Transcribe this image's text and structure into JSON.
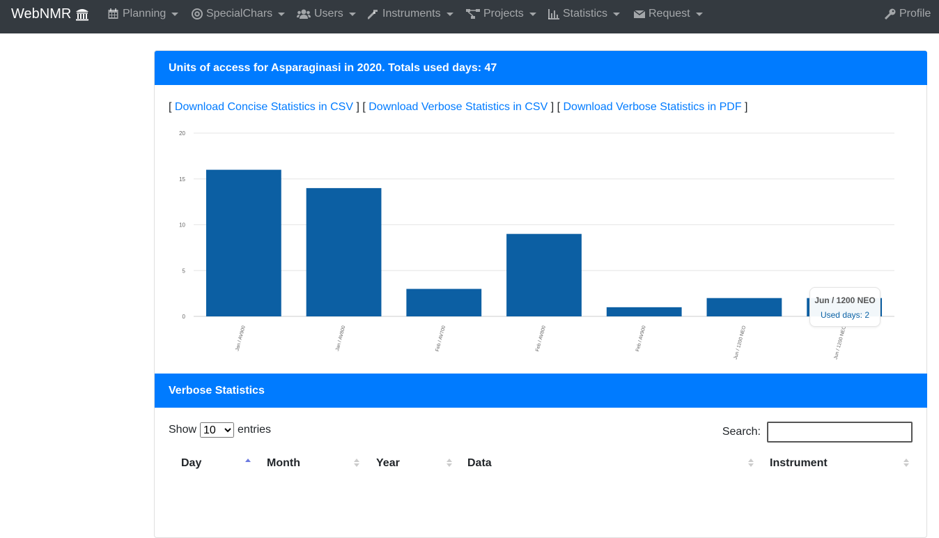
{
  "navbar": {
    "brand": "WebNMR",
    "items": [
      {
        "label": "Planning",
        "icon": "calendar-icon"
      },
      {
        "label": "SpecialChars",
        "icon": "at-icon"
      },
      {
        "label": "Users",
        "icon": "users-icon"
      },
      {
        "label": "Instruments",
        "icon": "wrench-icon"
      },
      {
        "label": "Projects",
        "icon": "sitemap-icon"
      },
      {
        "label": "Statistics",
        "icon": "bar-chart-icon"
      },
      {
        "label": "Request",
        "icon": "envelope-icon"
      }
    ],
    "profile": "Profile"
  },
  "card": {
    "title": "Units of access for Asparaginasi in 2020. Totals used days: 47",
    "links": {
      "concise_csv": "Download Concise Statistics in CSV",
      "verbose_csv": "Download Verbose Statistics in CSV",
      "verbose_pdf": "Download Verbose Statistics in PDF"
    }
  },
  "chart_data": {
    "type": "bar",
    "categories": [
      "Jan / AV900",
      "Jan / AV800",
      "Feb / AV700",
      "Feb / AV800",
      "Feb / AV900",
      "Jun / 1200 NEO",
      "Jun / 1200 NEO"
    ],
    "values": [
      16,
      14,
      3,
      9,
      1,
      2,
      2
    ],
    "ylim": [
      0,
      20
    ],
    "yticks": [
      0,
      5,
      10,
      15,
      20
    ],
    "bar_color": "#0c5fa3",
    "grid": true,
    "tooltip": {
      "title": "Jun / 1200 NEO",
      "text": "Used days: 2"
    }
  },
  "verbose": {
    "title": "Verbose Statistics",
    "show_label": "Show",
    "entries_label": "entries",
    "page_size": "10",
    "search_label": "Search:",
    "columns": [
      "Day",
      "Month",
      "Year",
      "Data",
      "Instrument"
    ]
  },
  "colors": {
    "navbar": "#343a40",
    "primary": "#007bff"
  }
}
